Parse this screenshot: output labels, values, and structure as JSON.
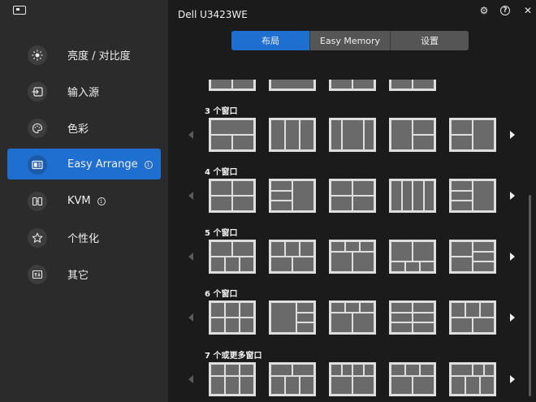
{
  "window": {
    "title": "Dell U3423WE",
    "settings_icon": "gear-icon",
    "help_icon": "help-icon",
    "close_icon": "close-icon",
    "help_glyph": "?",
    "close_glyph": "✕",
    "settings_glyph": "⚙"
  },
  "sidebar": {
    "items": [
      {
        "label": "亮度 / 对比度",
        "icon": "brightness-icon",
        "active": false
      },
      {
        "label": "输入源",
        "icon": "input-source-icon",
        "active": false
      },
      {
        "label": "色彩",
        "icon": "palette-icon",
        "active": false
      },
      {
        "label": "Easy Arrange",
        "icon": "easy-arrange-icon",
        "active": true,
        "info": "i"
      },
      {
        "label": "KVM",
        "icon": "kvm-icon",
        "active": false,
        "info": "i"
      },
      {
        "label": "个性化",
        "icon": "star-icon",
        "active": false
      },
      {
        "label": "其它",
        "icon": "others-icon",
        "active": false
      }
    ],
    "accent_color": "#1f6fd0"
  },
  "tabs": [
    {
      "label": "布局",
      "active": true
    },
    {
      "label": "Easy Memory",
      "active": false
    },
    {
      "label": "设置",
      "active": false
    }
  ],
  "sections": [
    {
      "label": "3 个窗口"
    },
    {
      "label": "4 个窗口"
    },
    {
      "label": "5 个窗口"
    },
    {
      "label": "6 个窗口"
    },
    {
      "label": "7 个或更多窗口"
    }
  ]
}
